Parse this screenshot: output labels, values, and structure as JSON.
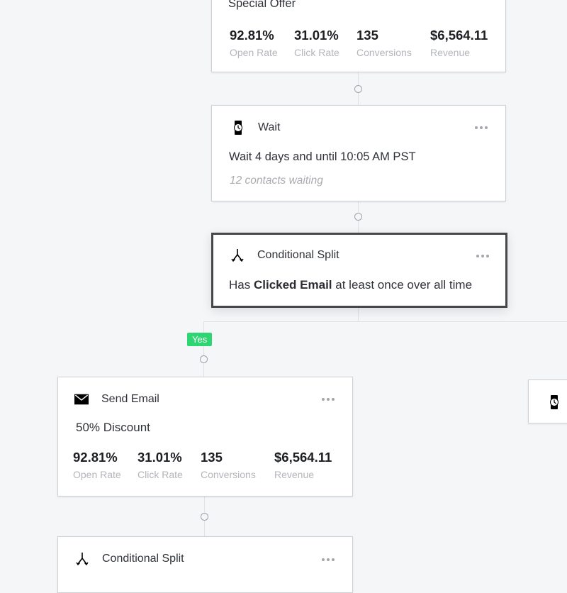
{
  "nodes": {
    "email_top": {
      "title": "Special Offer",
      "stats": [
        {
          "value": "92.81%",
          "label": "Open Rate"
        },
        {
          "value": "31.01%",
          "label": "Click Rate"
        },
        {
          "value": "135",
          "label": "Conversions"
        },
        {
          "value": "$6,564.11",
          "label": "Revenue"
        }
      ]
    },
    "wait": {
      "type_label": "Wait",
      "icon": "watch-icon",
      "description": "Wait 4 days and until 10:05 AM PST",
      "status": "12 contacts waiting"
    },
    "split_1": {
      "type_label": "Conditional Split",
      "icon": "split-icon",
      "condition_prefix": "Has",
      "condition_bold": "Clicked Email",
      "condition_suffix": "at least once over all time"
    },
    "yes_branch": {
      "label": "Yes",
      "color": "#2ed573"
    },
    "send_email": {
      "type_label": "Send Email",
      "icon": "envelope-icon",
      "subject": "50% Discount",
      "stats": [
        {
          "value": "92.81%",
          "label": "Open Rate"
        },
        {
          "value": "31.01%",
          "label": "Click Rate"
        },
        {
          "value": "135",
          "label": "Conversions"
        },
        {
          "value": "$6,564.11",
          "label": "Revenue"
        }
      ]
    },
    "no_branch_wait": {
      "icon": "watch-icon"
    },
    "split_2": {
      "type_label": "Conditional Split",
      "icon": "split-icon"
    }
  }
}
